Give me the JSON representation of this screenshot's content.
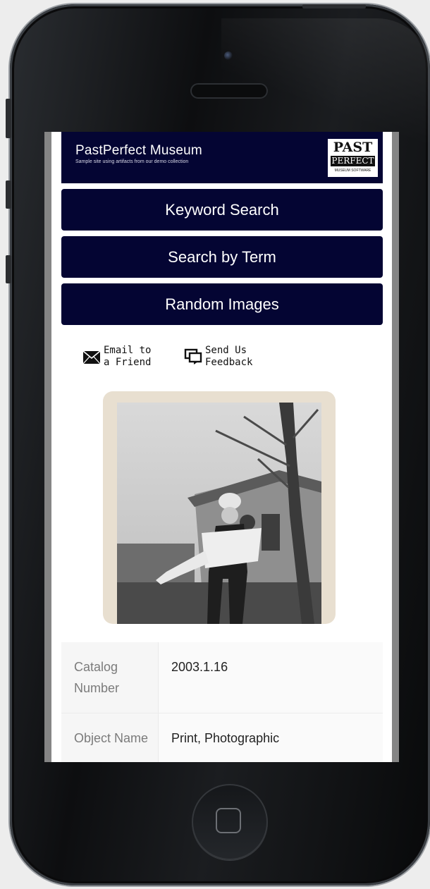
{
  "site": {
    "title": "PastPerfect Museum",
    "subtitle": "Sample site using artifacts from our demo collection",
    "logo": {
      "line1": "PAST",
      "line2": "PERFECT",
      "line3": "MUSEUM SOFTWARE"
    }
  },
  "nav": {
    "buttons": [
      {
        "label": "Keyword Search"
      },
      {
        "label": "Search by Term"
      },
      {
        "label": "Random Images"
      }
    ]
  },
  "actions": {
    "email": {
      "line1": "Email to",
      "line2": "a Friend",
      "icon": "envelope-icon"
    },
    "feedback": {
      "line1": "Send Us",
      "line2": "Feedback",
      "icon": "chat-bubbles-icon"
    }
  },
  "record": {
    "fields": [
      {
        "label_line1": "Catalog",
        "label_line2": "Number",
        "value": "2003.1.16"
      },
      {
        "label_line1": "Object Name",
        "label_line2": "",
        "value": "Print, Photographic"
      }
    ]
  },
  "colors": {
    "brand_navy": "#040533",
    "photo_border": "#e8dfd0"
  }
}
